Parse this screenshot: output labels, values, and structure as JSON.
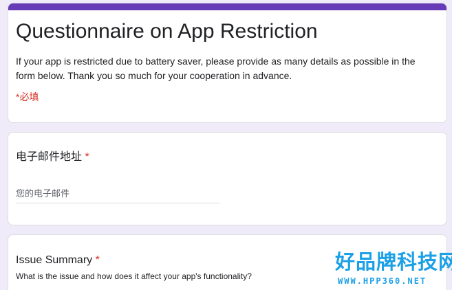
{
  "colors": {
    "accent": "#673ab7",
    "background": "#f0ebf8",
    "required": "#d93025",
    "watermark": "#1ca0e6"
  },
  "form": {
    "title": "Questionnaire on App Restriction",
    "description": "If your app is restricted due to battery saver, please provide as many details as possible in the form below. Thank you so much for your cooperation in advance.",
    "required_note": "*必填"
  },
  "questions": {
    "email": {
      "label": "电子邮件地址",
      "required_mark": "*",
      "placeholder": "您的电子邮件",
      "value": ""
    },
    "issue_summary": {
      "label": "Issue Summary",
      "required_mark": "*",
      "help_text": "What is the issue and how does it affect your app's functionality?"
    }
  },
  "watermark": {
    "brand": "好品牌科技网",
    "url": "WWW.HPP360.NET"
  }
}
